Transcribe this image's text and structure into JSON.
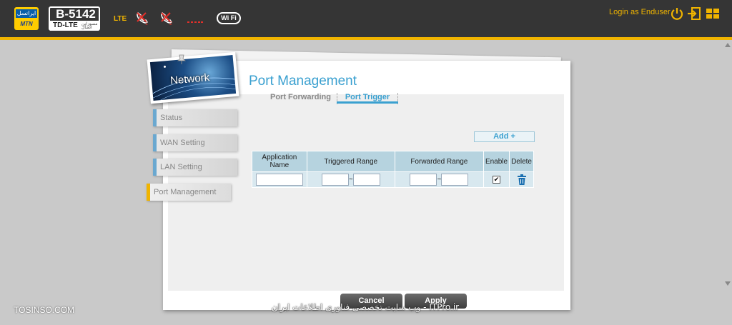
{
  "header": {
    "operator_logo_fa": "ایرانسل",
    "operator_logo_en": "MTN",
    "model": "B-5142",
    "model_sub": "TD-LTE",
    "model_sub_fa": "مسوزاین اتصال",
    "network_mode": "LTE",
    "phone1_index": "1",
    "phone2_index": "2",
    "wifi_label": "Wi Fi",
    "login_text": "Login as Enduser",
    "icons": [
      "power-icon",
      "logout-icon",
      "layout-icon"
    ],
    "accent_color": "#f0b400"
  },
  "section_badge": "Network",
  "sidebar": {
    "items": [
      {
        "label": "Status"
      },
      {
        "label": "WAN Setting"
      },
      {
        "label": "LAN Setting"
      },
      {
        "label": "Port Management"
      }
    ],
    "active_item": "Port Management"
  },
  "page": {
    "title": "Port Management",
    "tabs": [
      {
        "label": "Port Forwarding"
      },
      {
        "label": "Port Trigger"
      }
    ],
    "active_tab": "Port Trigger",
    "add_button": "Add +"
  },
  "table": {
    "columns": [
      "Application Name",
      "Triggered Range",
      "Forwarded Range",
      "Enable",
      "Delete"
    ],
    "rows": [
      {
        "application_name": "",
        "triggered_from": "",
        "triggered_to": "",
        "forwarded_from": "",
        "forwarded_to": "",
        "enabled": true
      }
    ],
    "range_separator": "~"
  },
  "footer": {
    "cancel_label": "Cancel",
    "apply_label": "Apply",
    "watermark_fa": "ITPro.ir - وب سایت تخصصی فناوری اطلاعات ایران",
    "watermark_left": "TOSINSO.COM"
  }
}
